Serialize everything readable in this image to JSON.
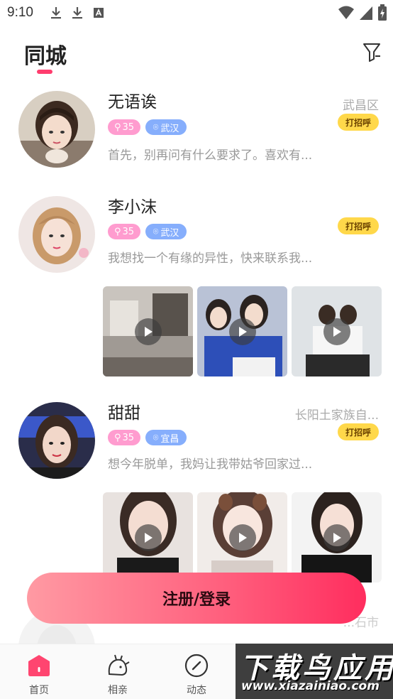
{
  "status_bar": {
    "time": "9:10",
    "left_icons": [
      "download-icon",
      "download-icon",
      "a-icon"
    ],
    "right_icons": [
      "wifi-icon",
      "signal-icon",
      "battery-charging-icon"
    ]
  },
  "header": {
    "title": "同城",
    "accent_color": "#ff3d6e",
    "filter_icon": "filter-icon"
  },
  "users": [
    {
      "name": "无语诶",
      "location": "武昌区",
      "age": "35",
      "city": "武汉",
      "bio": "首先，别再问有什么要求了。喜欢有...",
      "greet_label": "打招呼",
      "photos": []
    },
    {
      "name": "李小沫",
      "location": "",
      "age": "35",
      "city": "武汉",
      "bio": "我想找一个有缘的异性，快来联系我...",
      "greet_label": "打招呼",
      "photos": [
        "video-1",
        "video-2",
        "video-3"
      ]
    },
    {
      "name": "甜甜",
      "location": "长阳土家族自...",
      "age": "35",
      "city": "宜昌",
      "bio": "想今年脱单，我妈让我带姑爷回家过...",
      "greet_label": "打招呼",
      "photos": [
        "video-4",
        "video-5",
        "video-6"
      ]
    },
    {
      "name": "",
      "location": "...石市",
      "age": "",
      "city": "",
      "bio": "",
      "greet_label": "",
      "photos": []
    }
  ],
  "register_button": {
    "label": "注册/登录"
  },
  "bottom_nav": {
    "items": [
      {
        "label": "首页",
        "icon": "home-icon",
        "active": true
      },
      {
        "label": "相亲",
        "icon": "blind-date-icon",
        "active": false
      },
      {
        "label": "动态",
        "icon": "compass-icon",
        "active": false
      }
    ]
  },
  "watermark": {
    "title": "下载鸟应用",
    "url": "www.xiazainiao.com"
  },
  "colors": {
    "pink_badge": "#ff9ccf",
    "blue_badge": "#86aefc",
    "greet_yellow": "#ffd84a",
    "register_gradient_end": "#ff2d5e"
  }
}
